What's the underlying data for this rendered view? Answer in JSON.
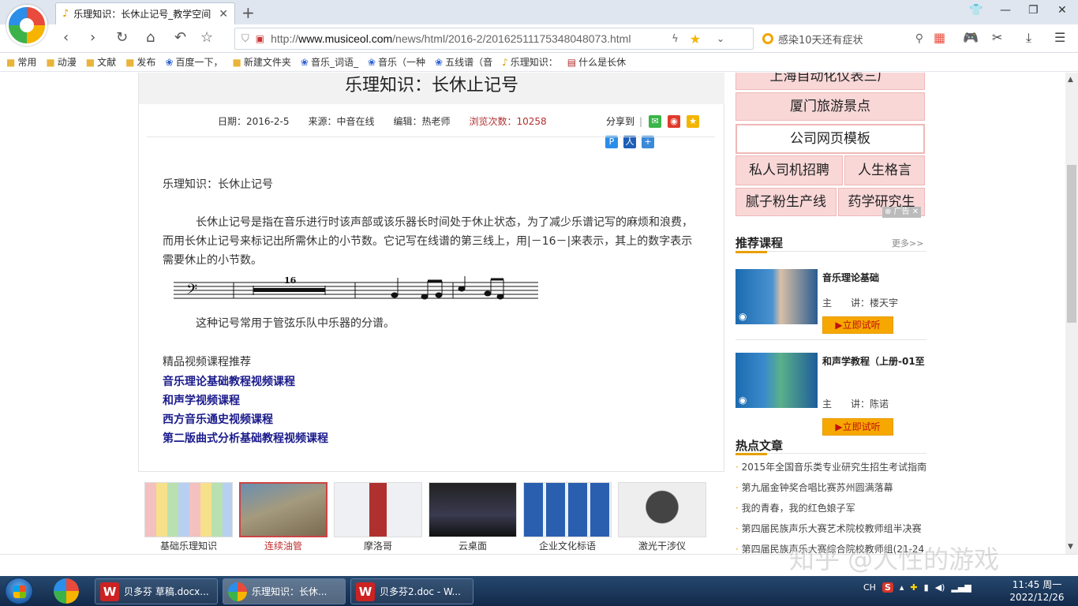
{
  "browser": {
    "tab_title": "乐理知识：长休止记号_教学空间",
    "url_prefix": "http://",
    "url_host": "www.musiceol.com",
    "url_path": "/news/html/2016-2/20162511175348048073.html",
    "search_placeholder": "感染10天还有症状",
    "new_tab": "+"
  },
  "bookmarks": [
    {
      "label": "常用",
      "icon": "folder-icon"
    },
    {
      "label": "动漫",
      "icon": "folder-icon"
    },
    {
      "label": "文献",
      "icon": "folder-icon"
    },
    {
      "label": "发布",
      "icon": "folder-icon"
    },
    {
      "label": "百度一下，",
      "icon": "baidu-paw-icon"
    },
    {
      "label": "新建文件夹",
      "icon": "folder-icon"
    },
    {
      "label": "音乐_词语_",
      "icon": "baidu-paw-icon"
    },
    {
      "label": "音乐（一种",
      "icon": "baidu-paw-icon"
    },
    {
      "label": "五线谱（音",
      "icon": "baidu-paw-icon"
    },
    {
      "label": "乐理知识：",
      "icon": "music-page-icon"
    },
    {
      "label": "什么是长休",
      "icon": "doc-page-icon"
    }
  ],
  "article": {
    "title": "乐理知识：长休止记号",
    "date": "日期：2016-2-5",
    "source": "来源：中音在线",
    "editor": "编辑：热老师",
    "views": "浏览次数：10258",
    "share_label": "分享到",
    "heading": "乐理知识：长休止记号",
    "para1": "长休止记号是指在音乐进行时该声部或该乐器长时间处于休止状态，为了减少乐谱记写的麻烦和浪费，而用长休止记号来标记出所需休止的小节数。它记写在线谱的第三线上，用|－16－|来表示，其上的数字表示需要休止的小节数。",
    "staff_number": "16",
    "para2": "这种记号常用于管弦乐队中乐器的分谱。",
    "rec_title": "精品视频课程推荐",
    "rec_links": [
      "音乐理论基础教程视频课程",
      "和声学视频课程",
      "西方音乐通史视频课程",
      "第二版曲式分析基础教程视频课程"
    ]
  },
  "thumbnails": [
    "基础乐理知识",
    "连续油管",
    "摩洛哥",
    "云桌面",
    "企业文化标语",
    "激光干涉仪"
  ],
  "sidebar": {
    "ads": [
      "上海自动化仪表三厂",
      "厦门旅游景点",
      "公司网页模板",
      "私人司机招聘",
      "人生格言",
      "腻子粉生产线",
      "药学研究生"
    ],
    "ad_close": "⊗ 广告 ✕",
    "rec_section": "推荐课程",
    "more": "更多>>",
    "courses": [
      {
        "name": "音乐理论基础",
        "teacher": "主　　讲：楼天宇",
        "button": "▶立即试听"
      },
      {
        "name": "和声学教程（上册-01至",
        "teacher": "主　　讲：陈诺",
        "button": "▶立即试听"
      }
    ],
    "hot_section": "热点文章",
    "hot": [
      "2015年全国音乐类专业研究生招生考试指南",
      "第九届金钟奖合唱比赛苏州圆满落幕",
      "我的青春，我的红色娘子军",
      "第四届民族声乐大赛艺术院校教师组半决赛",
      "第四届民族声乐大赛综合院校教师组(21-24"
    ]
  },
  "watermark": "知乎 @人性的游戏",
  "taskbar": {
    "tasks": [
      "贝多芬 草稿.docx...",
      "乐理知识：长休...",
      "贝多芬2.doc - W..."
    ],
    "ime": "CH",
    "time": "11:45 周一",
    "date": "2022/12/26"
  },
  "colors": {
    "accent_link": "#1a1a8c",
    "ad_pink": "#f9d7d7",
    "try_button": "#f6a800",
    "views_red": "#b03030"
  }
}
